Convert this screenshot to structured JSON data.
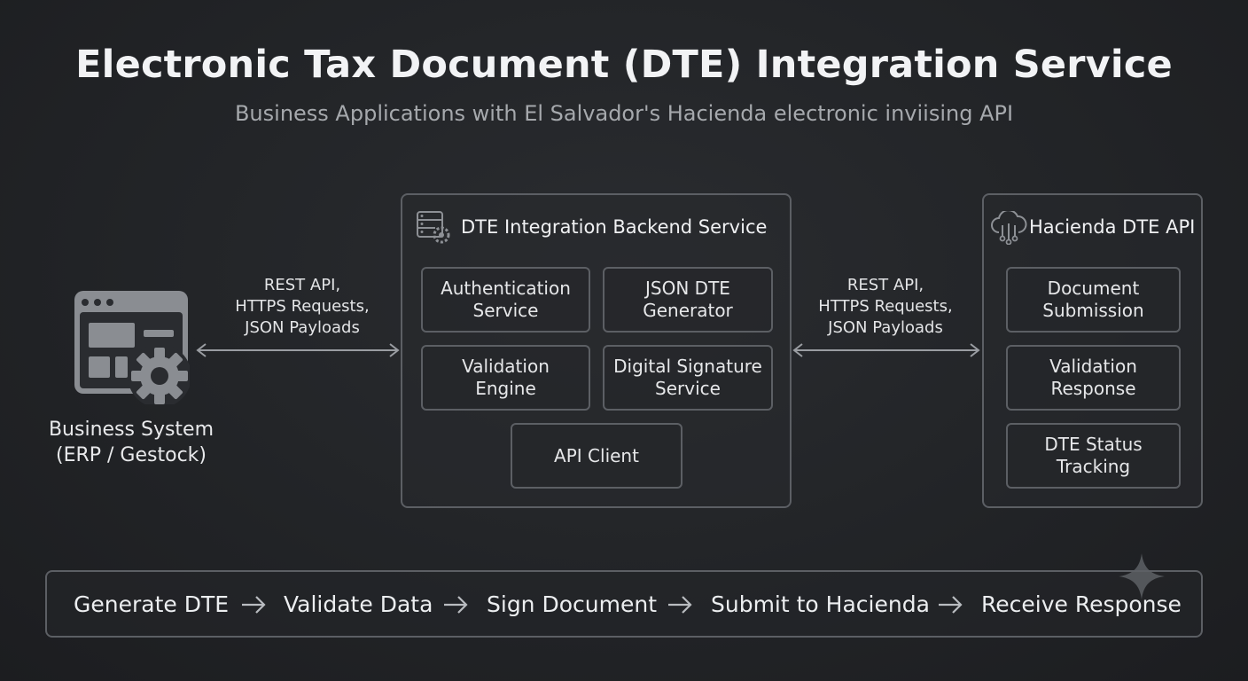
{
  "title": "Electronic Tax Document (DTE) Integration Service",
  "subtitle": "Business Applications with El Salvador's Hacienda electronic inviising API",
  "business_system": {
    "label": "Business System\n(ERP / Gestock)",
    "icon": "app-window-gear-icon"
  },
  "left_connection": {
    "label": "REST API,\nHTTPS Requests,\nJSON Payloads"
  },
  "right_connection": {
    "label": "REST API,\nHTTPS Requests,\nJSON Payloads"
  },
  "backend": {
    "title": "DTE Integration Backend Service",
    "icon": "server-gear-icon",
    "components": [
      "Authentication\nService",
      "JSON DTE\nGenerator",
      "Validation\nEngine",
      "Digital Signature\nService",
      "API Client"
    ]
  },
  "hacienda": {
    "title": "Hacienda DTE API",
    "icon": "cloud-network-icon",
    "components": [
      "Document\nSubmission",
      "Validation\nResponse",
      "DTE Status\nTracking"
    ]
  },
  "flow": {
    "steps": [
      "Generate DTE",
      "Validate Data",
      "Sign Document",
      "Submit to Hacienda",
      "Receive Response"
    ],
    "arrow_icon": "arrow-right-icon"
  },
  "colors": {
    "background": "#222427",
    "border": "#5c5f64",
    "text": "#e8e9eb",
    "icon": "#8d9095"
  }
}
